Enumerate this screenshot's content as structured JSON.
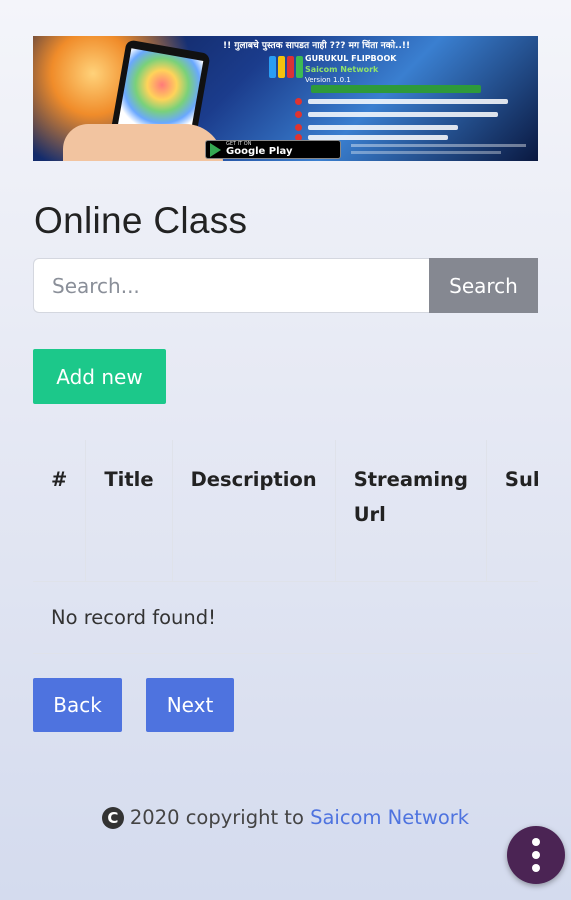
{
  "banner": {
    "headline": "!! गुलाबचे पुस्तक सापडत नाही ???     मग चिंता नको..!!",
    "title": "GURUKUL FLIPBOOK",
    "subtitle": "Saicom Network",
    "version": "Version 1.0.1",
    "store_small": "GET IT ON",
    "store_big": "Google Play"
  },
  "page": {
    "title": "Online Class"
  },
  "search": {
    "placeholder": "Search...",
    "button_label": "Search"
  },
  "actions": {
    "add_label": "Add new"
  },
  "table": {
    "headers": [
      "#",
      "Title",
      "Description",
      "Streaming Url",
      "Sub"
    ],
    "empty_message": "No record found!"
  },
  "pagination": {
    "back_label": "Back",
    "next_label": "Next"
  },
  "footer": {
    "icon": "C",
    "text": "2020 copyright to ",
    "link_text": "Saicom Network"
  },
  "colors": {
    "add_button": "#1cc88a",
    "search_button": "#858891",
    "pager_button": "#4e73df",
    "link": "#4e73df",
    "fab": "#4b2454"
  },
  "icons": {
    "fab": "more-vertical-icon",
    "copyright": "copyright-icon"
  }
}
